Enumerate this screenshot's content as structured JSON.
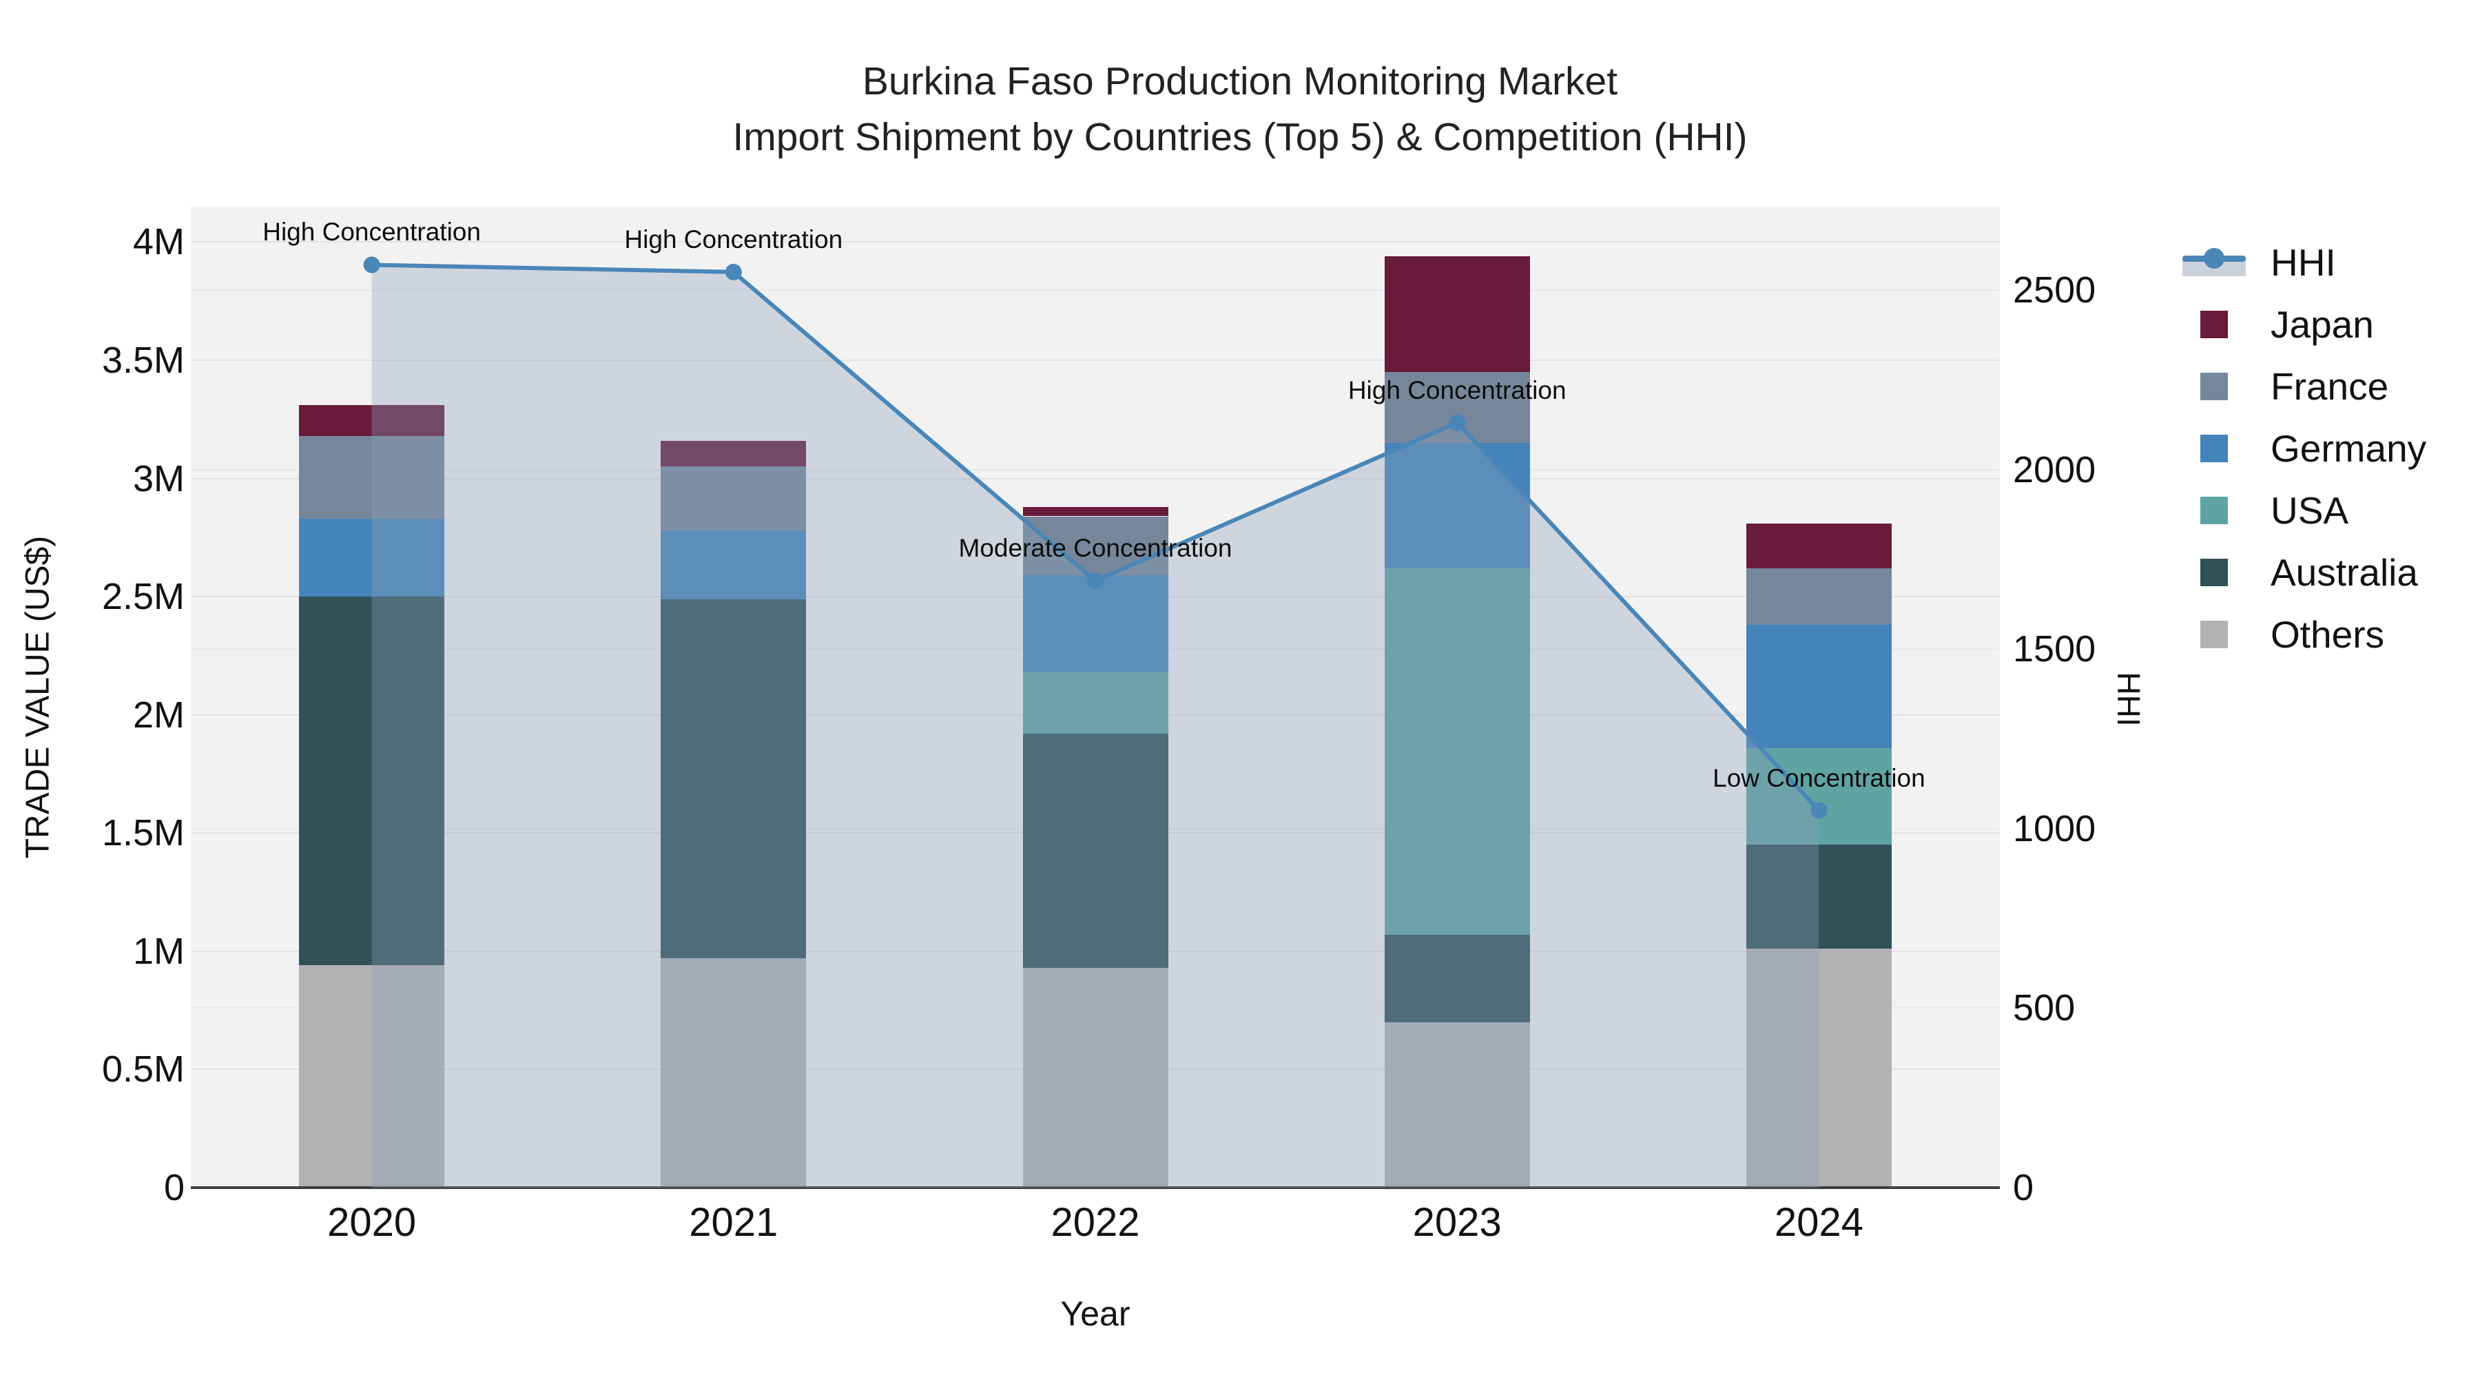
{
  "title": {
    "line1": "Burkina Faso Production Monitoring Market",
    "line2": "Import Shipment by Countries (Top 5) & Competition (HHI)"
  },
  "legend": {
    "items": [
      {
        "label": "HHI",
        "type": "line",
        "color": "#4a86b8"
      },
      {
        "label": "Japan",
        "type": "swatch",
        "color": "#681b3b"
      },
      {
        "label": "France",
        "type": "swatch",
        "color": "#76879b"
      },
      {
        "label": "Germany",
        "type": "swatch",
        "color": "#4484ba"
      },
      {
        "label": "USA",
        "type": "swatch",
        "color": "#5fa4a2"
      },
      {
        "label": "Australia",
        "type": "swatch",
        "color": "#2f5157"
      },
      {
        "label": "Others",
        "type": "swatch",
        "color": "#b2b2b4"
      }
    ]
  },
  "chart_data": {
    "type": "combo",
    "bar_mode": "stacked",
    "values_unit": "million US$",
    "categories": [
      "2020",
      "2021",
      "2022",
      "2023",
      "2024"
    ],
    "bar_series": [
      {
        "name": "Others",
        "color": "#b2b2b4",
        "values": [
          0.94,
          0.97,
          0.93,
          0.7,
          1.01
        ]
      },
      {
        "name": "Australia",
        "color": "#2f5157",
        "values": [
          1.56,
          1.52,
          0.99,
          0.37,
          0.44
        ]
      },
      {
        "name": "USA",
        "color": "#5fa4a2",
        "values": [
          0.0,
          0.0,
          0.26,
          1.55,
          0.41
        ]
      },
      {
        "name": "Germany",
        "color": "#4484ba",
        "values": [
          0.33,
          0.29,
          0.41,
          0.53,
          0.52
        ]
      },
      {
        "name": "France",
        "color": "#76879b",
        "values": [
          0.35,
          0.27,
          0.25,
          0.3,
          0.24
        ]
      },
      {
        "name": "Japan",
        "color": "#681b3b",
        "values": [
          0.13,
          0.11,
          0.04,
          0.49,
          0.19
        ]
      }
    ],
    "bar_totals": [
      3.31,
      3.16,
      2.88,
      3.94,
      2.81
    ],
    "line_series": {
      "name": "HHI",
      "color": "#4a86b8",
      "area_color": "rgba(140,160,185,0.35)",
      "values": [
        2570,
        2550,
        1690,
        2130,
        1050
      ]
    },
    "point_annotations": [
      "High Concentration",
      "High Concentration",
      "Moderate Concentration",
      "High Concentration",
      "Low Concentration"
    ],
    "y_left": {
      "label": "TRADE VALUE (US$)",
      "max": 4.15,
      "ticks": [
        {
          "v": 0,
          "label": "0"
        },
        {
          "v": 0.5,
          "label": "0.5M"
        },
        {
          "v": 1,
          "label": "1M"
        },
        {
          "v": 1.5,
          "label": "1.5M"
        },
        {
          "v": 2,
          "label": "2M"
        },
        {
          "v": 2.5,
          "label": "2.5M"
        },
        {
          "v": 3,
          "label": "3M"
        },
        {
          "v": 3.5,
          "label": "3.5M"
        },
        {
          "v": 4,
          "label": "4M"
        }
      ]
    },
    "y_right": {
      "label": "HHI",
      "max": 2732,
      "ticks": [
        {
          "v": 0,
          "label": "0"
        },
        {
          "v": 500,
          "label": "500"
        },
        {
          "v": 1000,
          "label": "1000"
        },
        {
          "v": 1500,
          "label": "1500"
        },
        {
          "v": 2000,
          "label": "2000"
        },
        {
          "v": 2500,
          "label": "2500"
        }
      ]
    },
    "x_label": "Year",
    "legend_position": "right",
    "grid": true
  },
  "colors": {
    "plot_bg": "#f2f2f3",
    "grid": "#e2e2e5",
    "axis_line": "#3f3f41",
    "text": "#111111"
  }
}
